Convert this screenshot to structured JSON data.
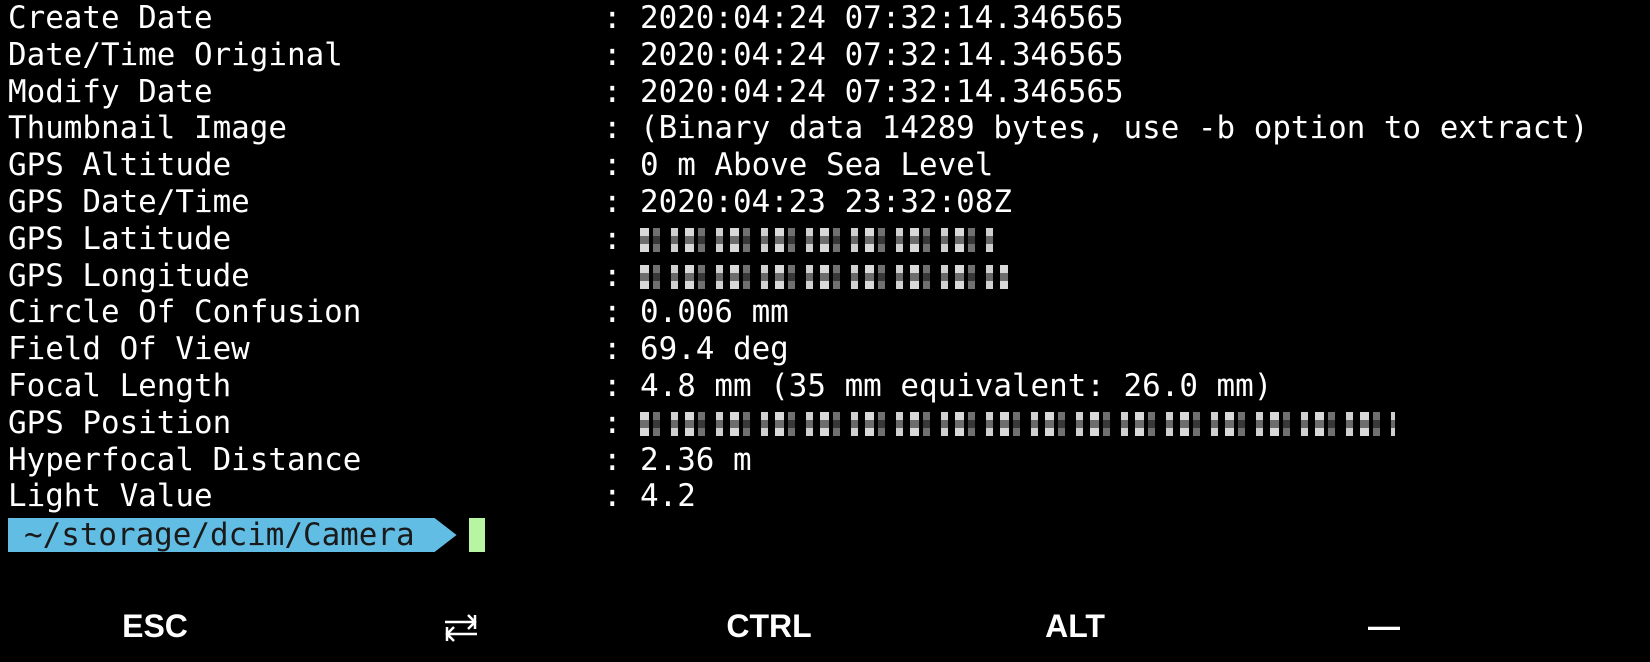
{
  "terminal": {
    "lines": [
      {
        "tag": "Create Date",
        "value": "2020:04:24 07:32:14.346565"
      },
      {
        "tag": "Date/Time Original",
        "value": "2020:04:24 07:32:14.346565"
      },
      {
        "tag": "Modify Date",
        "value": "2020:04:24 07:32:14.346565"
      },
      {
        "tag": "Thumbnail Image",
        "value": "(Binary data 14289 bytes, use -b option to extract)"
      },
      {
        "tag": "GPS Altitude",
        "value": "0 m Above Sea Level"
      },
      {
        "tag": "GPS Date/Time",
        "value": "2020:04:23 23:32:08Z"
      },
      {
        "tag": "GPS Latitude",
        "value": null,
        "redacted": true
      },
      {
        "tag": "GPS Longitude",
        "value": null,
        "redacted": true
      },
      {
        "tag": "Circle Of Confusion",
        "value": "0.006 mm"
      },
      {
        "tag": "Field Of View",
        "value": "69.4 deg"
      },
      {
        "tag": "Focal Length",
        "value": "4.8 mm (35 mm equivalent: 26.0 mm)"
      },
      {
        "tag": "GPS Position",
        "value": null,
        "redacted": true
      },
      {
        "tag": "Hyperfocal Distance",
        "value": "2.36 m"
      },
      {
        "tag": "Light Value",
        "value": "4.2"
      }
    ],
    "separator": ":",
    "prompt": {
      "path": "~/storage/dcim/Camera",
      "color": "#62bde4"
    },
    "cursor_color": "#b7f5a3"
  },
  "extra_keys": [
    {
      "label": "ESC",
      "icon": null
    },
    {
      "label": null,
      "icon": "tab-arrows-icon"
    },
    {
      "label": "CTRL",
      "icon": null
    },
    {
      "label": "ALT",
      "icon": null
    },
    {
      "label": "—",
      "icon": null
    }
  ]
}
